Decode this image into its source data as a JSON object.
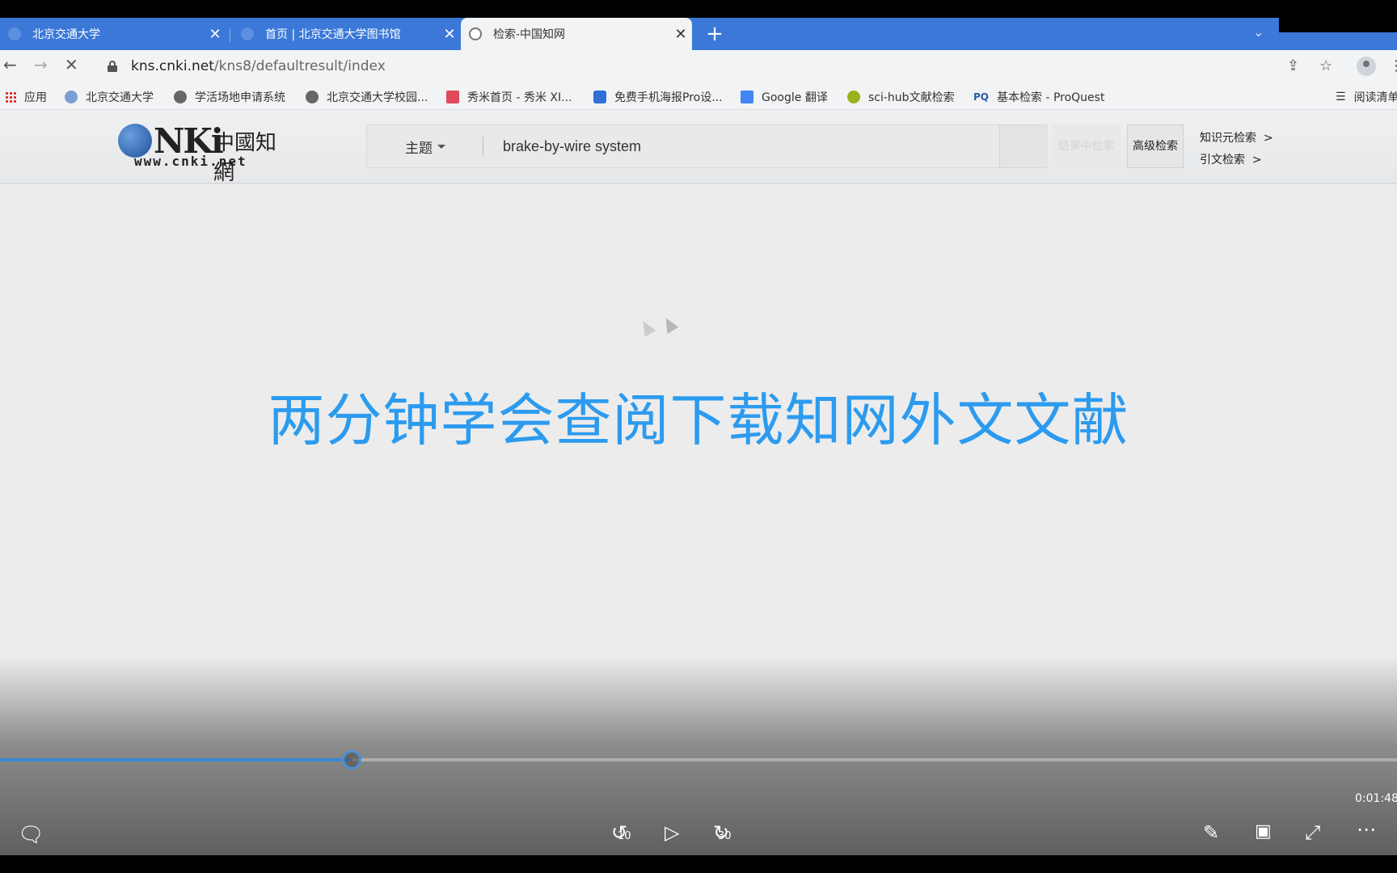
{
  "browser": {
    "tabs": [
      {
        "title": "北京交通大学",
        "active": false
      },
      {
        "title": "首页 | 北京交通大学图书馆",
        "active": false
      },
      {
        "title": "检索-中国知网",
        "active": true
      }
    ],
    "url_host": "kns.cnki.net",
    "url_path": "/kns8/defaultresult/index",
    "bookmarks": [
      {
        "label": "应用",
        "icon": "apps-grid-icon"
      },
      {
        "label": "北京交通大学",
        "icon": "university-icon"
      },
      {
        "label": "学活场地申请系统",
        "icon": "globe-icon"
      },
      {
        "label": "北京交通大学校园...",
        "icon": "globe-icon"
      },
      {
        "label": "秀米首页 - 秀米 XI...",
        "icon": "xiumi-icon"
      },
      {
        "label": "免费手机海报Pro设...",
        "icon": "poster-icon"
      },
      {
        "label": "Google 翻译",
        "icon": "google-translate-icon"
      },
      {
        "label": "sci-hub文献检索",
        "icon": "scihub-icon"
      },
      {
        "label": "基本检索 - ProQuest",
        "icon": "proquest-icon"
      },
      {
        "label": "阅读清单",
        "icon": "reading-list-icon"
      }
    ],
    "proquest_badge": "PQ"
  },
  "cnki": {
    "logo_main": "NKi",
    "logo_cn": "中國知網",
    "logo_url": "www.cnki.net",
    "field_select": "主题",
    "search_value": "brake-by-wire system",
    "within_button": "结果中检索",
    "advanced_button": "高级检索",
    "knowledge_link": "知识元检索",
    "citation_link": "引文检索",
    "link_arrow": ">"
  },
  "headline": "两分钟学会查阅下载知网外文文献",
  "video": {
    "timecode": "0:01:48",
    "progress": 0.252,
    "rewind_seconds": "10",
    "forward_seconds": "30"
  },
  "colors": {
    "tab_strip": "#3b78d8",
    "headline": "#2c9bef",
    "progress": "#3a86d6"
  }
}
